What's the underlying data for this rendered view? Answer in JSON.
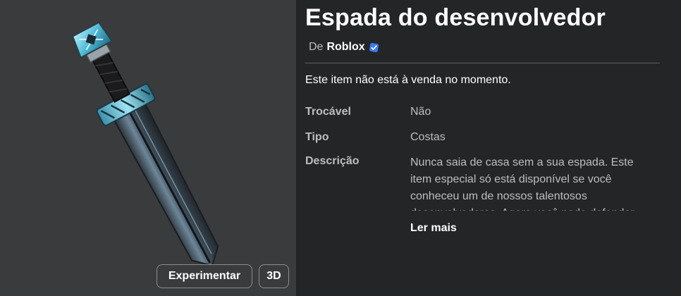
{
  "item": {
    "title": "Espada do desenvolvedor",
    "creator_prefix": "De",
    "creator_name": "Roblox",
    "sale_status": "Este item não está à venda no momento.",
    "details": {
      "tradable_label": "Trocável",
      "tradable_value": "Não",
      "type_label": "Tipo",
      "type_value": "Costas",
      "description_label": "Descrição",
      "description_text": "Nunca saia de casa sem a sua espada. Este item especial só está disponível se você conheceu um de nossos talentosos desenvolvedores. Agora você pode defender",
      "read_more": "Ler mais"
    }
  },
  "preview": {
    "try_on_label": "Experimentar",
    "view_3d_label": "3D"
  },
  "icons": {
    "verified": "verified-badge-icon",
    "item_image": "sword-icon"
  },
  "colors": {
    "background": "#232527",
    "preview_bg": "#393b3d",
    "verified_blue": "#3a7bf7",
    "text_secondary": "#bdbebe"
  }
}
